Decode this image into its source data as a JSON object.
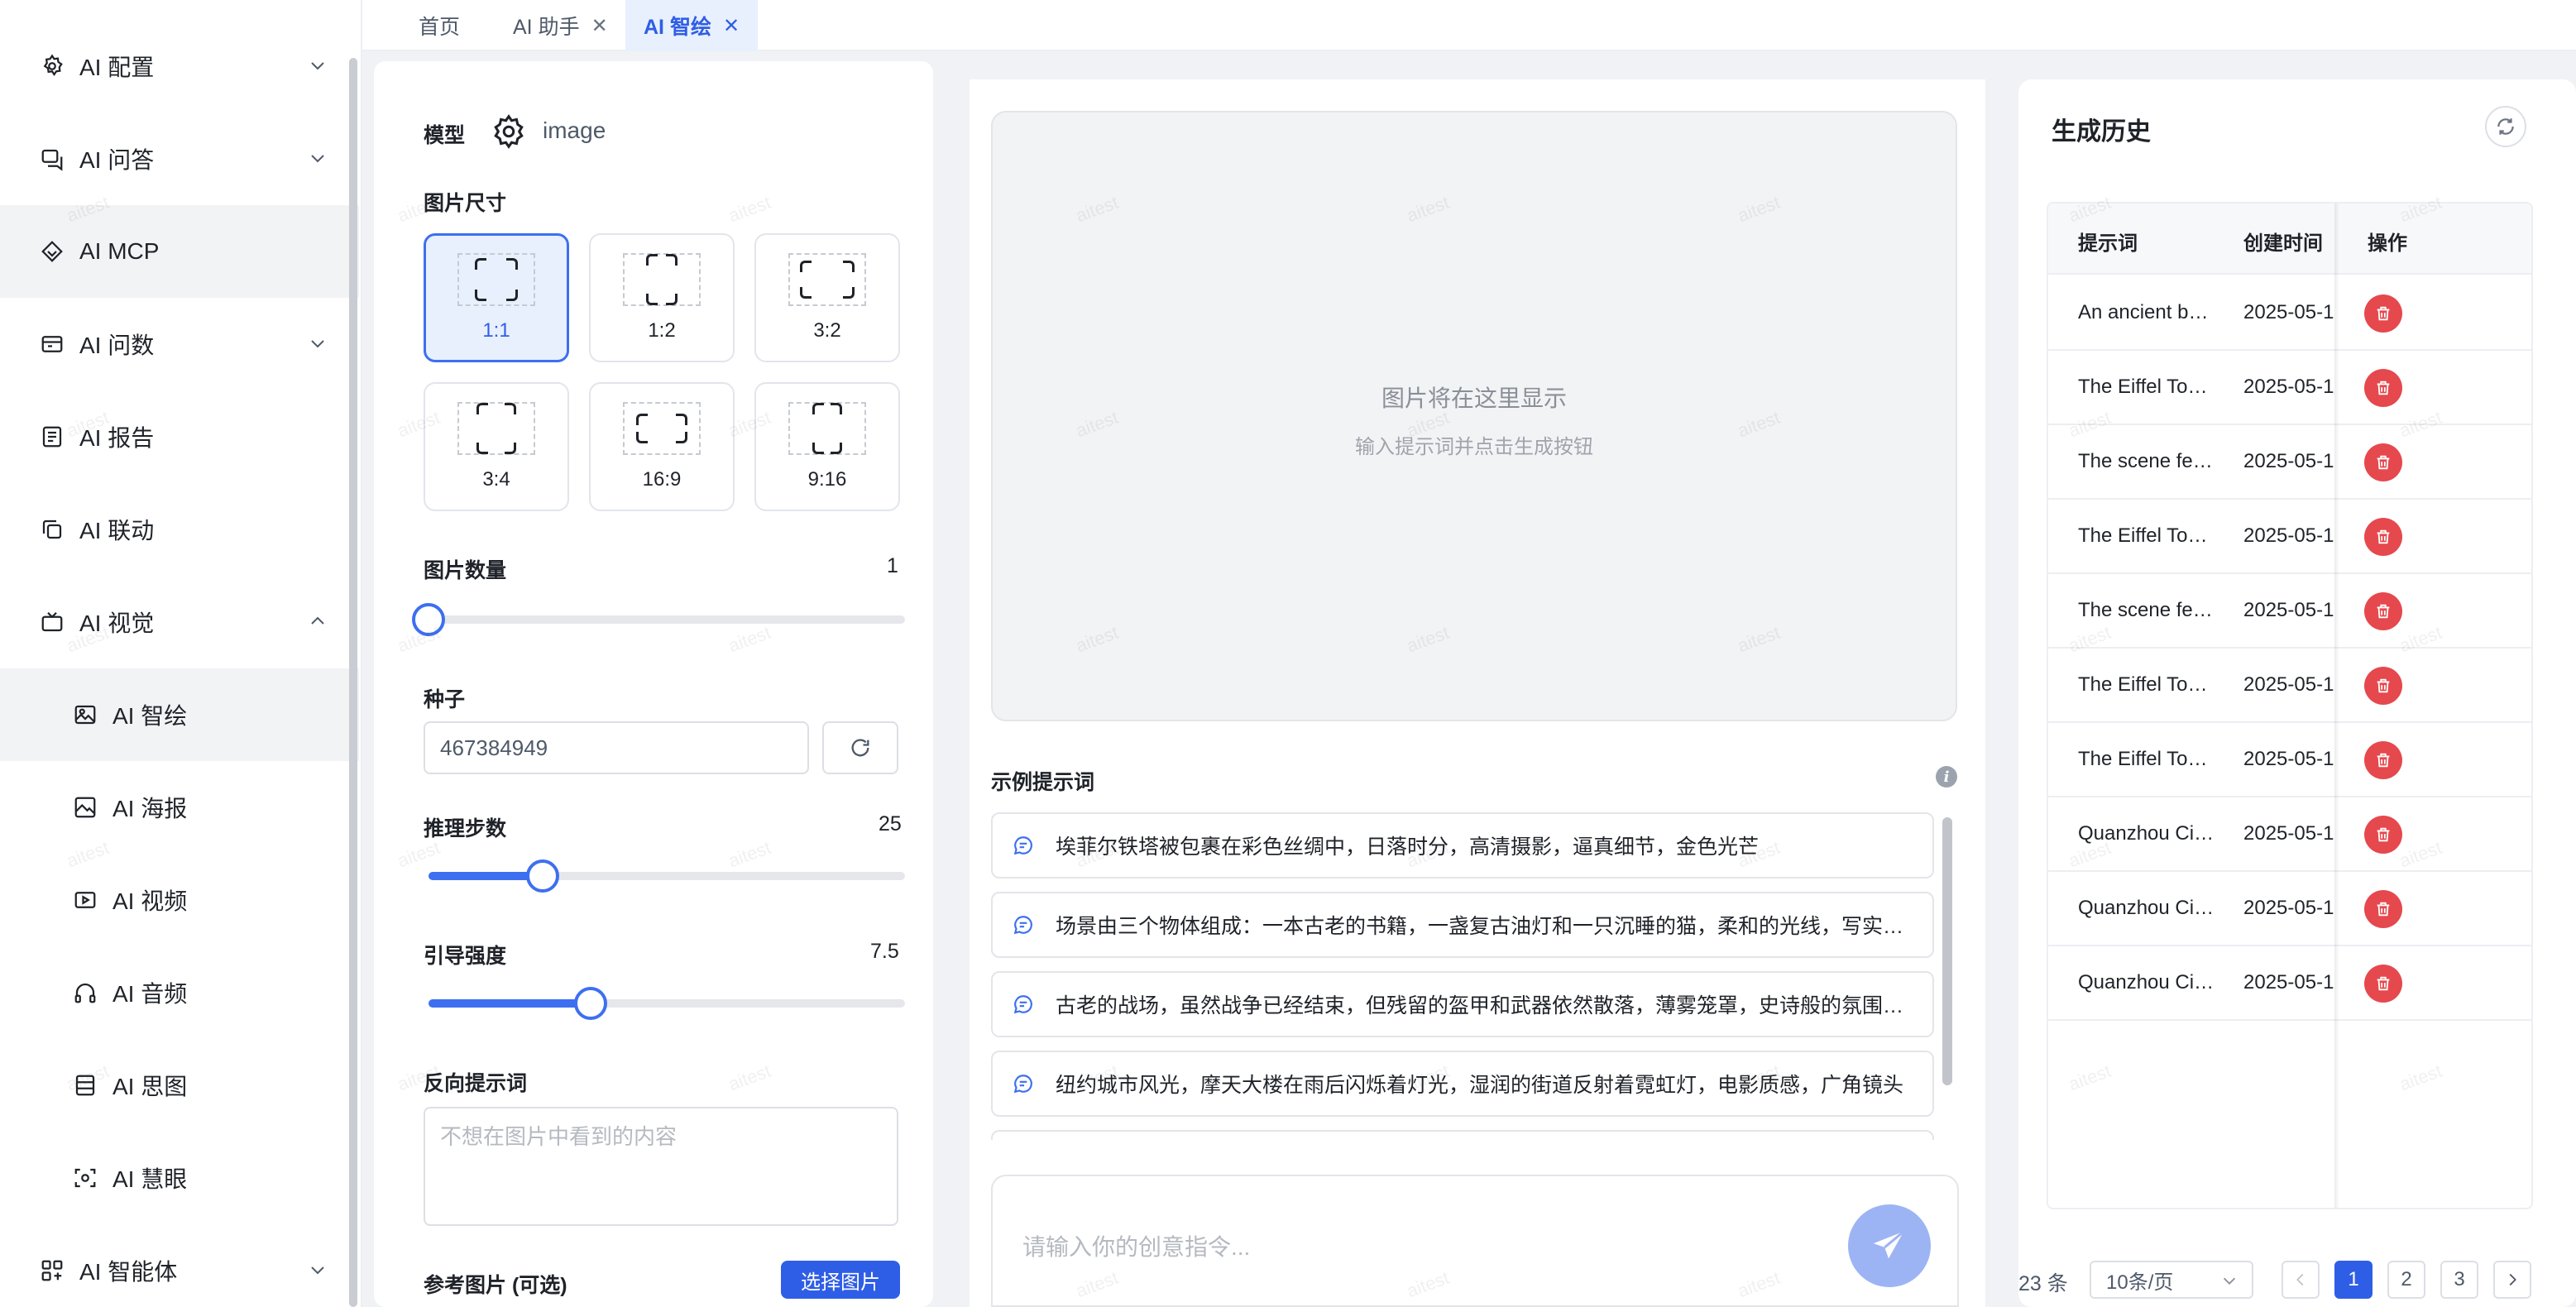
{
  "sidebar": {
    "items": [
      {
        "label": "AI 配置",
        "icon": "gear-icon",
        "arrow": "down"
      },
      {
        "label": "AI 问答",
        "icon": "chat-icon",
        "arrow": "down"
      },
      {
        "label": "AI MCP",
        "icon": "layers-icon",
        "arrow": ""
      },
      {
        "label": "AI 问数",
        "icon": "database-icon",
        "arrow": "down"
      },
      {
        "label": "AI 报告",
        "icon": "document-icon",
        "arrow": ""
      },
      {
        "label": "AI 联动",
        "icon": "copy-icon",
        "arrow": ""
      },
      {
        "label": "AI 视觉",
        "icon": "tv-icon",
        "arrow": "up"
      }
    ],
    "children": [
      {
        "label": "AI 智绘",
        "icon": "image-icon"
      },
      {
        "label": "AI 海报",
        "icon": "poster-icon"
      },
      {
        "label": "AI 视频",
        "icon": "video-icon"
      },
      {
        "label": "AI 音频",
        "icon": "headphones-icon"
      },
      {
        "label": "AI 思图",
        "icon": "stack-icon"
      },
      {
        "label": "AI 慧眼",
        "icon": "scan-icon"
      }
    ],
    "bottom": {
      "label": "AI 智能体",
      "icon": "apps-icon",
      "arrow": "down"
    }
  },
  "tabs": [
    {
      "label": "首页",
      "closable": false
    },
    {
      "label": "AI 助手",
      "closable": true
    },
    {
      "label": "AI 智绘",
      "closable": true,
      "active": true
    }
  ],
  "settings": {
    "model_label": "模型",
    "model_value": "image",
    "size_label": "图片尺寸",
    "sizes": [
      "1:1",
      "1:2",
      "3:2",
      "3:4",
      "16:9",
      "9:16"
    ],
    "selected_size": "1:1",
    "count_label": "图片数量",
    "count_value": "1",
    "count_fraction": 0,
    "seed_label": "种子",
    "seed_value": "467384949",
    "steps_label": "推理步数",
    "steps_value": "25",
    "steps_fraction": 0.24,
    "guidance_label": "引导强度",
    "guidance_value": "7.5",
    "guidance_fraction": 0.34,
    "negative_label": "反向提示词",
    "negative_placeholder": "不想在图片中看到的内容",
    "reference_label": "参考图片 (可选)",
    "select_image_button": "选择图片"
  },
  "preview": {
    "title": "图片将在这里显示",
    "subtitle": "输入提示词并点击生成按钮"
  },
  "examples": {
    "title": "示例提示词",
    "items": [
      "埃菲尔铁塔被包裹在彩色丝绸中，日落时分，高清摄影，逼真细节，金色光芒",
      "场景由三个物体组成：一本古老的书籍，一盏复古油灯和一只沉睡的猫，柔和的光线，写实风格",
      "古老的战场，虽然战争已经结束，但残留的盔甲和武器依然散落，薄雾笼罩，史诗般的氛围，电影质感",
      "纽约城市风光，摩天大楼在雨后闪烁着灯光，湿润的街道反射着霓虹灯，电影质感，广角镜头"
    ]
  },
  "chat": {
    "placeholder": "请输入你的创意指令..."
  },
  "history": {
    "title": "生成历史",
    "columns": [
      "提示词",
      "创建时间",
      "操作"
    ],
    "rows": [
      {
        "prompt": "An ancient book with an oil lamp",
        "time": "2025-05-1"
      },
      {
        "prompt": "The Eiffel Tower wrapped in silk",
        "time": "2025-05-1"
      },
      {
        "prompt": "The scene features three objects",
        "time": "2025-05-1"
      },
      {
        "prompt": "The Eiffel Tower wrapped in silk",
        "time": "2025-05-1"
      },
      {
        "prompt": "The scene features three objects",
        "time": "2025-05-1"
      },
      {
        "prompt": "The Eiffel Tower wrapped in silk",
        "time": "2025-05-1"
      },
      {
        "prompt": "The Eiffel Tower wrapped in silk",
        "time": "2025-05-1"
      },
      {
        "prompt": "Quanzhou City night view",
        "time": "2025-05-1"
      },
      {
        "prompt": "Quanzhou City night view",
        "time": "2025-05-1"
      },
      {
        "prompt": "Quanzhou City night view",
        "time": "2025-05-1"
      }
    ],
    "total": "23 条",
    "page_size": "10条/页",
    "pages": [
      "1",
      "2",
      "3"
    ],
    "current_page": "1"
  },
  "watermark": "aitest",
  "colors": {
    "primary": "#2f5ee6",
    "danger": "#e5484d",
    "send": "#9db4f4"
  }
}
